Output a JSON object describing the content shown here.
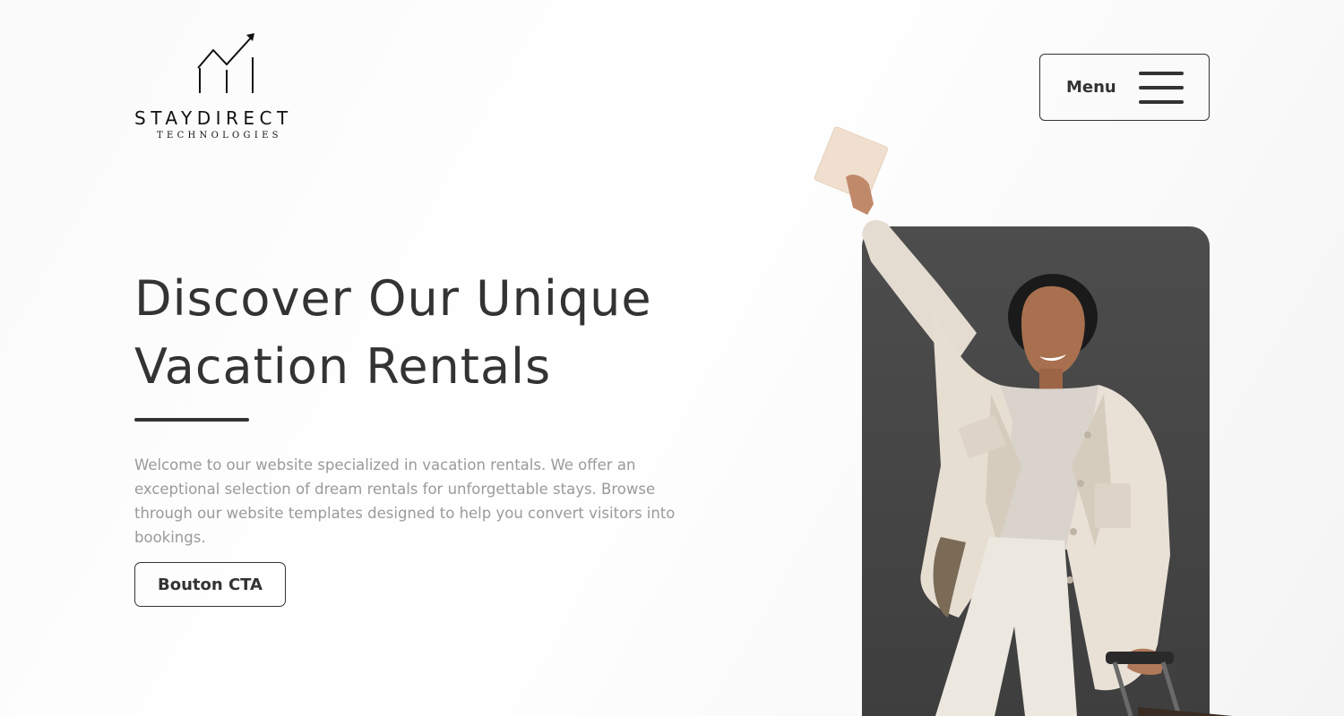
{
  "header": {
    "logo": {
      "brand": "STAYDIRECT",
      "sub": "TECHNOLOGIES",
      "icon": "chart-growth-icon"
    },
    "menu": {
      "label": "Menu",
      "icon": "hamburger-icon"
    }
  },
  "hero": {
    "title_line1": "Discover Our Unique",
    "title_line2": "Vacation Rentals",
    "description": "Welcome to our website specialized in vacation rentals. We offer an exceptional selection of dream rentals for unforgettable stays. Browse through our website templates designed to help you convert visitors into bookings.",
    "cta_label": "Bouton CTA"
  },
  "colors": {
    "text_dark": "#333333",
    "text_muted": "#9a9a9a",
    "panel_bg": "#474747",
    "page_bg": "#fafafa"
  }
}
